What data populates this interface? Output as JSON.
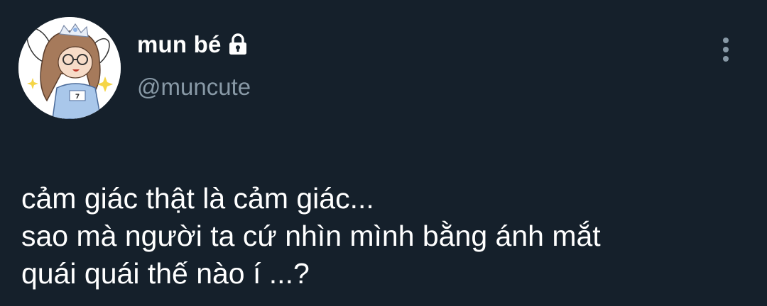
{
  "user": {
    "display_name": "mun bé",
    "handle": "@muncute",
    "avatar_icon": "cartoon-girl-avatar",
    "protected_icon": "lock-icon"
  },
  "menu_icon": "more-vertical-icon",
  "tweet": {
    "lines": [
      "cảm giác thật là cảm giác...",
      "sao mà người ta cứ nhìn mình bằng ánh mắt",
      "quái quái thế nào í ...?"
    ]
  },
  "colors": {
    "background": "#15202b",
    "text_primary": "#ffffff",
    "text_secondary": "#8899a6"
  }
}
